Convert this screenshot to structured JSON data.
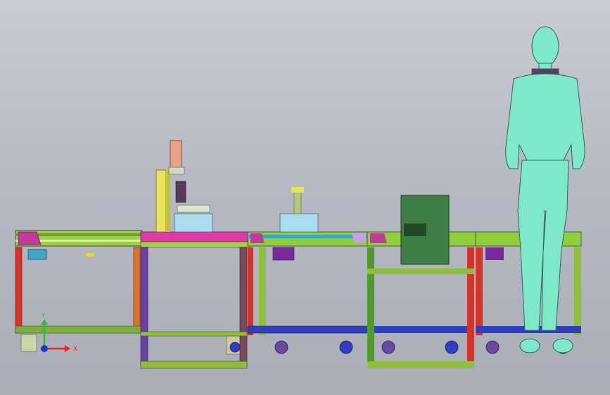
{
  "viewport": {
    "background_top": "#c9ccd3",
    "background_bottom": "#a9adb6"
  },
  "triad": {
    "x_label": "X",
    "y_label": "Y",
    "x_color": "#e8261c",
    "y_color": "#2fbf2f",
    "z_color": "#1f35d6"
  },
  "palette": {
    "frame_green": "#8fbf3a",
    "frame_dark_green": "#3f7a1e",
    "frame_red": "#d8332a",
    "frame_purple": "#6b3fa6",
    "frame_orange": "#d9742a",
    "belt_blue": "#2f3fbf",
    "magenta": "#c23a9e",
    "light_blue": "#a9dcee",
    "human": "#7ee8c9",
    "cabinet": "#3f7f46"
  },
  "icons": [
    "coordinate-triad-icon"
  ]
}
